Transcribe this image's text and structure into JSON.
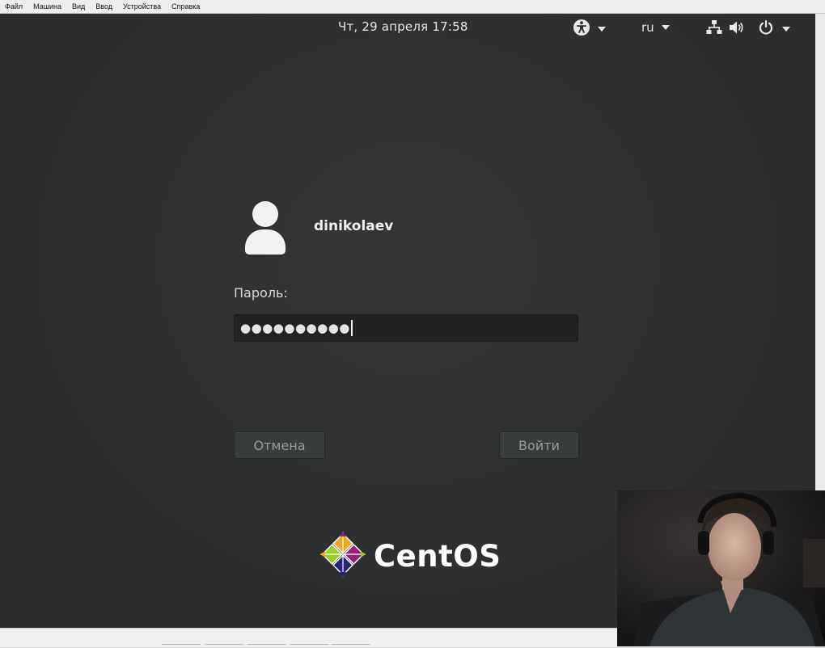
{
  "host_menu": [
    "Файл",
    "Машина",
    "Вид",
    "Ввод",
    "Устройства",
    "Справка"
  ],
  "topbar": {
    "clock": "Чт, 29 апреля  17:58",
    "accessibility_icon": "accessibility-icon",
    "language": "ru",
    "network_icon": "network-wired-icon",
    "volume_icon": "volume-icon",
    "power_icon": "power-icon"
  },
  "login": {
    "username": "dinikolaev",
    "password_label": "Пароль:",
    "password_mask": "●●●●●●●●●●",
    "cancel_label": "Отмена",
    "login_label": "Войти"
  },
  "branding": {
    "logo_text": "CentOS"
  },
  "colors": {
    "background": "#2e3031",
    "text": "#e8e8e8",
    "logo_green": "#9ccd2a",
    "logo_purple": "#932279",
    "logo_orange": "#efa724",
    "logo_blue": "#262577"
  }
}
